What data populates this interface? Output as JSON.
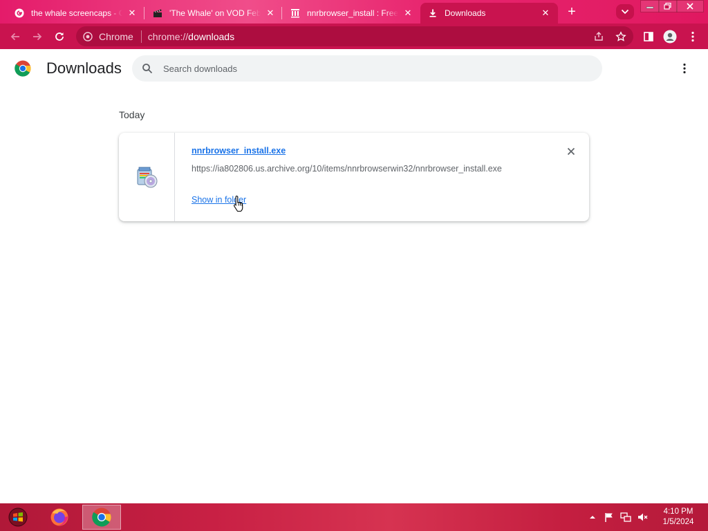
{
  "browser": {
    "tabs": [
      {
        "title": "the whale screencaps - G",
        "favicon": "google-icon",
        "active": false
      },
      {
        "title": "'The Whale' on VOD Feb",
        "favicon": "clapperboard-icon",
        "active": false
      },
      {
        "title": "nnrbrowser_install : Free",
        "favicon": "archive-icon",
        "active": false
      },
      {
        "title": "Downloads",
        "favicon": "download-icon",
        "active": true
      }
    ],
    "new_tab_label": "+",
    "omnibox": {
      "chip": "Chrome",
      "scheme": "chrome://",
      "host": "downloads"
    }
  },
  "page": {
    "title": "Downloads",
    "search_placeholder": "Search downloads",
    "date_group": "Today",
    "download": {
      "filename": "nnrbrowser_install.exe",
      "url": "https://ia802806.us.archive.org/10/items/nnrbrowserwin32/nnrbrowser_install.exe",
      "action": "Show in folder",
      "icon": "installer-icon"
    }
  },
  "taskbar": {
    "apps": [
      "start-orb-icon",
      "firefox-icon",
      "chrome-icon"
    ],
    "clock_time": "4:10 PM",
    "clock_date": "1/5/2024"
  },
  "colors": {
    "tab_strip": "#e8266f",
    "toolbar": "#c9134f",
    "link": "#1a73e8",
    "taskbar": "#c82044"
  }
}
